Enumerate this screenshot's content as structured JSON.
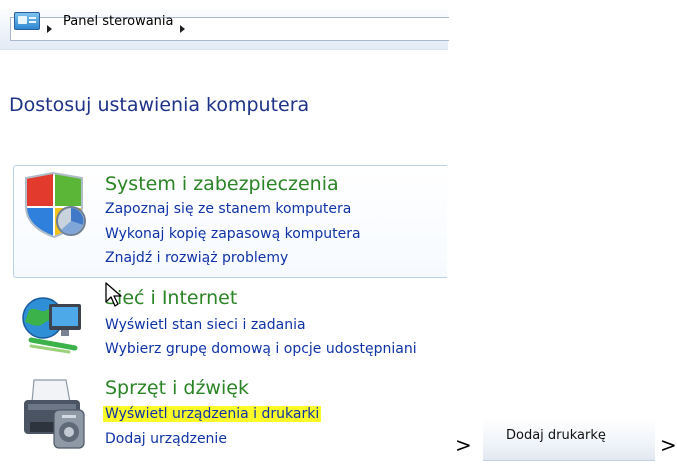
{
  "breadcrumb": {
    "items": [
      "Panel sterowania"
    ]
  },
  "page_title": "Dostosuj ustawienia komputera",
  "categories": [
    {
      "title": "System i zabezpieczenia",
      "icon": "shield-icon",
      "links": [
        "Zapoznaj się ze stanem komputera",
        "Wykonaj kopię zapasową komputera",
        "Znajdź i rozwiąż problemy"
      ]
    },
    {
      "title": "Sieć i Internet",
      "icon": "network-globe-icon",
      "links": [
        "Wyświetl stan sieci i zadania",
        "Wybierz grupę domową i opcje udostępniani"
      ]
    },
    {
      "title": "Sprzęt i dźwięk",
      "icon": "printer-icon",
      "links": [
        "Wyświetl urządzenia i drukarki",
        "Dodaj urządzenie"
      ]
    }
  ],
  "flow": {
    "arrow": ">",
    "next_button": "Dodaj drukarkę"
  },
  "colors": {
    "category_title": "#2b8425",
    "link": "#0f33a6",
    "page_title": "#1e3287",
    "highlight": "#fbfc28"
  }
}
